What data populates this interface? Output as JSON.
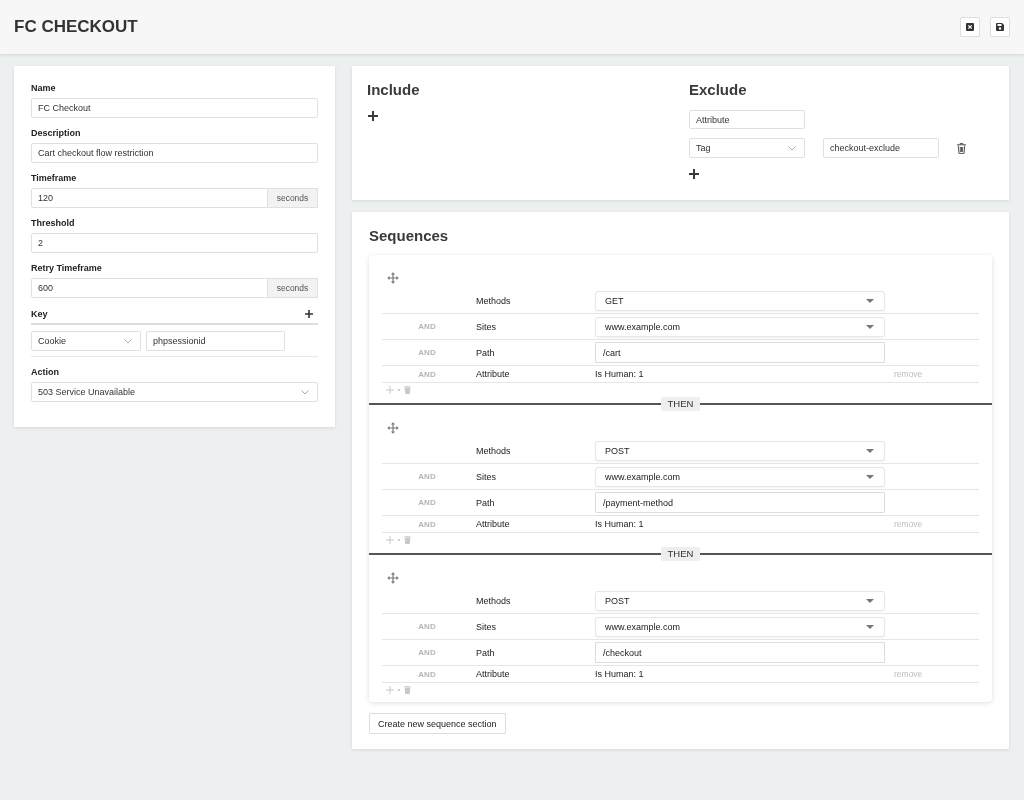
{
  "header": {
    "title": "FC CHECKOUT"
  },
  "settings": {
    "fields": [
      {
        "kind": "text",
        "label": "Name",
        "value": "FC Checkout"
      },
      {
        "kind": "text",
        "label": "Description",
        "value": "Cart checkout flow restriction"
      },
      {
        "kind": "unit",
        "label": "Timeframe",
        "value": "120",
        "unit": "seconds"
      },
      {
        "kind": "text",
        "label": "Threshold",
        "value": "2"
      },
      {
        "kind": "unit",
        "label": "Retry Timeframe",
        "value": "600",
        "unit": "seconds"
      }
    ],
    "key": {
      "label": "Key",
      "type": "Cookie",
      "value": "phpsessionid"
    },
    "action": {
      "label": "Action",
      "value": "503 Service Unavailable"
    }
  },
  "filters": {
    "include": {
      "title": "Include"
    },
    "exclude": {
      "title": "Exclude",
      "attribute": "Attribute",
      "entries": [
        {
          "type": "Tag",
          "value": "checkout-exclude"
        }
      ]
    }
  },
  "sequences": {
    "title": "Sequences",
    "sections": [
      {
        "conditions": [
          {
            "kind": "select",
            "label": "Methods",
            "value": "GET"
          },
          {
            "kind": "select",
            "connector": "AND",
            "label": "Sites",
            "value": "www.example.com"
          },
          {
            "kind": "input",
            "connector": "AND",
            "label": "Path",
            "value": "/cart"
          },
          {
            "kind": "attribute",
            "connector": "AND",
            "label": "Attribute",
            "value": "Is Human: 1",
            "remove": "remove"
          }
        ]
      },
      {
        "joiner": "THEN",
        "conditions": [
          {
            "kind": "select",
            "label": "Methods",
            "value": "POST"
          },
          {
            "kind": "select",
            "connector": "AND",
            "label": "Sites",
            "value": "www.example.com"
          },
          {
            "kind": "input",
            "connector": "AND",
            "label": "Path",
            "value": "/payment-method"
          },
          {
            "kind": "attribute",
            "connector": "AND",
            "label": "Attribute",
            "value": "Is Human: 1",
            "remove": "remove"
          }
        ]
      },
      {
        "joiner": "THEN",
        "conditions": [
          {
            "kind": "select",
            "label": "Methods",
            "value": "POST"
          },
          {
            "kind": "select",
            "connector": "AND",
            "label": "Sites",
            "value": "www.example.com"
          },
          {
            "kind": "input",
            "connector": "AND",
            "label": "Path",
            "value": "/checkout"
          },
          {
            "kind": "attribute",
            "connector": "AND",
            "label": "Attribute",
            "value": "Is Human: 1",
            "remove": "remove"
          }
        ]
      }
    ],
    "create_button": "Create new sequence section"
  }
}
